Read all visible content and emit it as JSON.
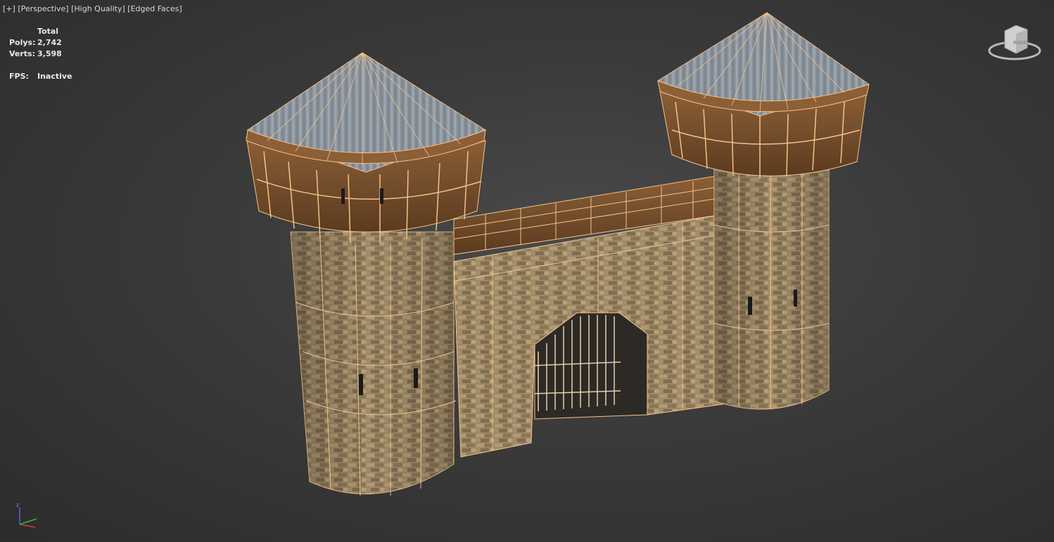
{
  "viewport": {
    "menu_plus": "[+]",
    "view_mode": "[Perspective]",
    "quality": "[High Quality]",
    "shading": "[Edged Faces]"
  },
  "stats": {
    "header": "Total",
    "polys_label": "Polys:",
    "polys_value": "2,742",
    "verts_label": "Verts:",
    "verts_value": "3,598",
    "fps_label": "FPS:",
    "fps_value": "Inactive"
  },
  "viewcube": {
    "face_label": "RIGHT"
  },
  "axis": {
    "z_label": "z",
    "colors": {
      "x": "#d23a3a",
      "y": "#3ab03a",
      "z": "#4a6ad8"
    }
  },
  "colors": {
    "wireframe": "#f4c28a",
    "stone": "#9b8462",
    "wood": "#7a5230",
    "roof": "#8e96a0"
  }
}
